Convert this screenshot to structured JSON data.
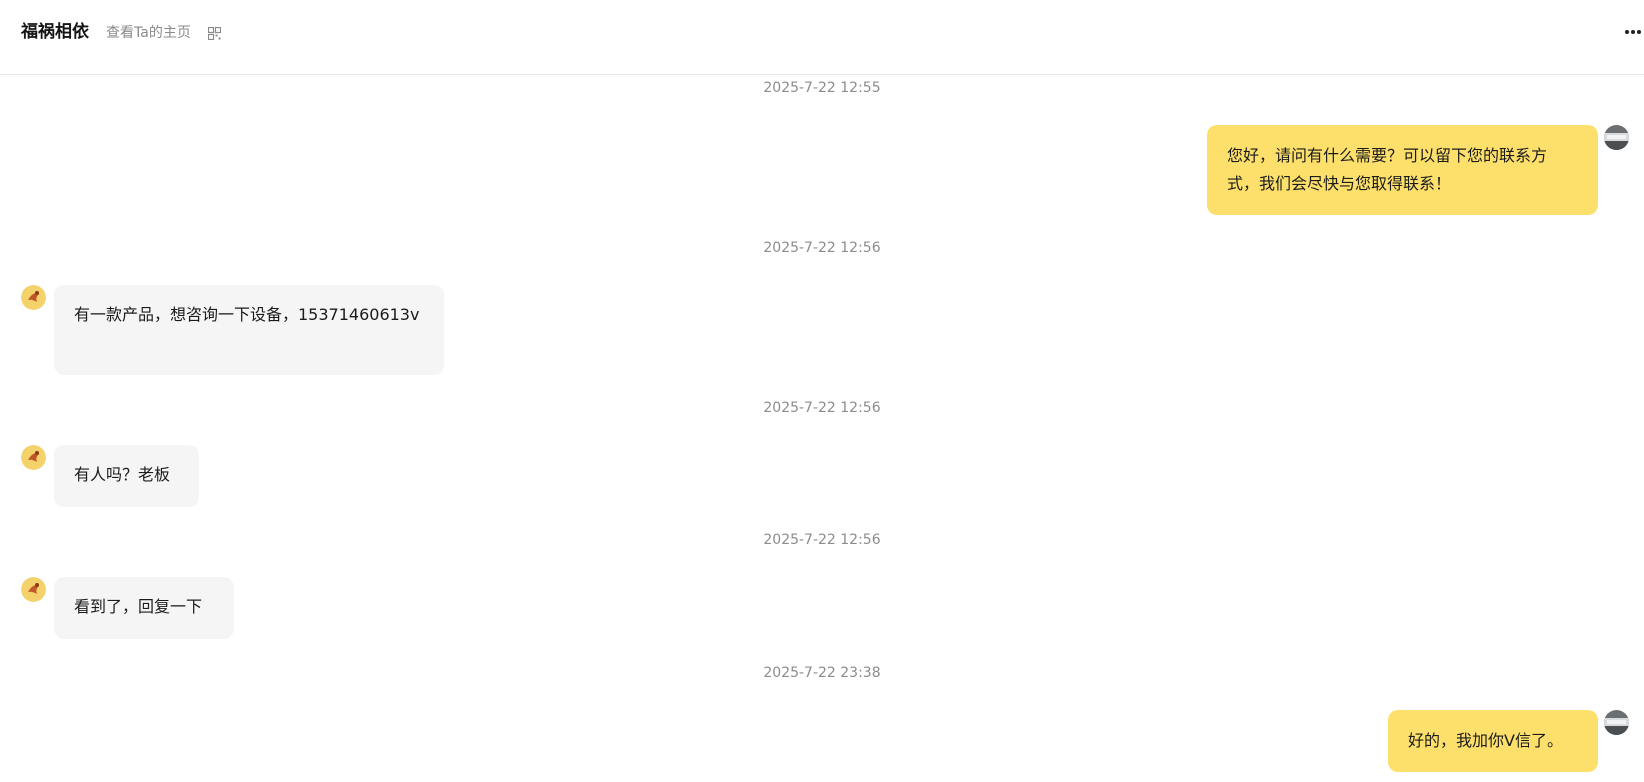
{
  "header": {
    "name": "福祸相依",
    "homepage_link": "查看Ta的主页",
    "qr_icon": "qrcode-icon",
    "more_icon": "more-horizontal-icon"
  },
  "messages": [
    {
      "time": "2025-7-22 12:55",
      "direction": "out",
      "text": "您好，请问有什么需要？可以留下您的联系方式，我们会尽快与您取得联系！"
    },
    {
      "time": "2025-7-22 12:56",
      "direction": "in",
      "text": "有一款产品，想咨询一下设备，15371460613v"
    },
    {
      "time": "2025-7-22 12:56",
      "direction": "in",
      "text": "有人吗？老板"
    },
    {
      "time": "2025-7-22 12:56",
      "direction": "in",
      "text": "看到了，回复一下"
    },
    {
      "time": "2025-7-22 23:38",
      "direction": "out",
      "text": "好的，我加你V信了。"
    }
  ],
  "colors": {
    "outgoing_bubble": "#fde06b",
    "incoming_bubble": "#f5f5f5",
    "timestamp": "#8c8c8c"
  }
}
